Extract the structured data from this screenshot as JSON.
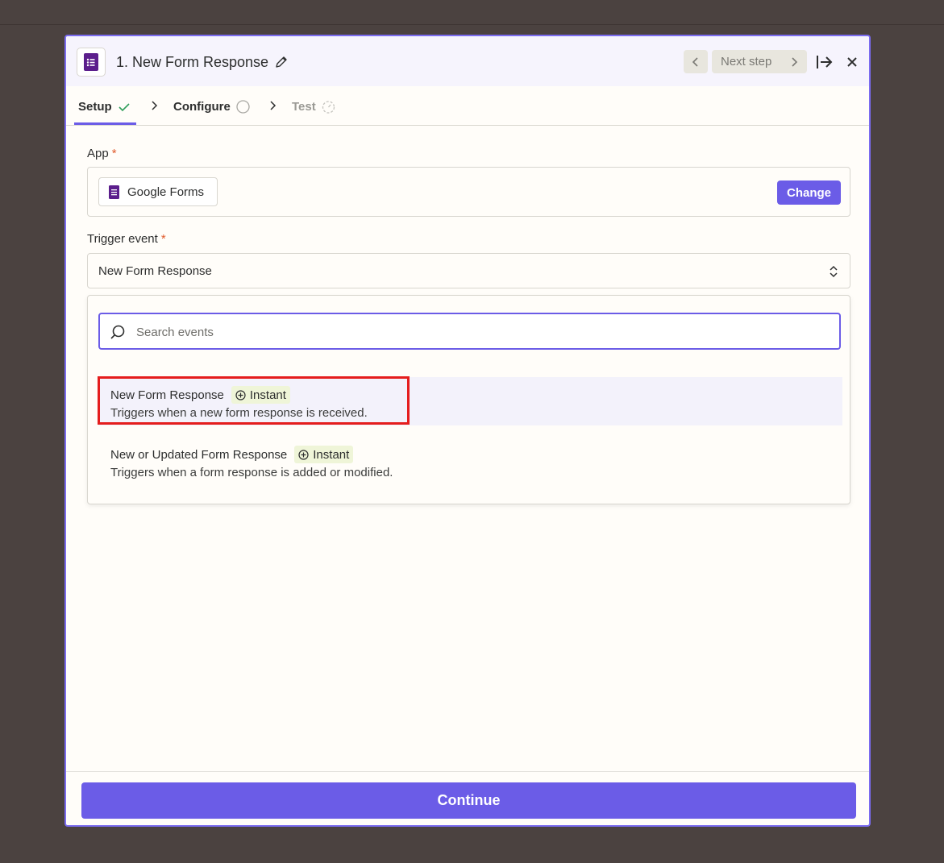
{
  "header": {
    "title": "1. New Form Response",
    "next_step_label": "Next step"
  },
  "tabs": [
    {
      "label": "Setup",
      "status": "complete"
    },
    {
      "label": "Configure",
      "status": "pending"
    },
    {
      "label": "Test",
      "status": "disabled"
    }
  ],
  "app_field": {
    "label": "App",
    "required_mark": "*",
    "app_name": "Google Forms",
    "change_label": "Change"
  },
  "trigger_field": {
    "label": "Trigger event",
    "required_mark": "*",
    "selected_value": "New Form Response"
  },
  "dropdown": {
    "search_placeholder": "Search events",
    "options": [
      {
        "title": "New Form Response",
        "badge": "Instant",
        "description": "Triggers when a new form response is received."
      },
      {
        "title": "New or Updated Form Response",
        "badge": "Instant",
        "description": "Triggers when a form response is added or modified."
      }
    ]
  },
  "footer": {
    "continue_label": "Continue"
  },
  "colors": {
    "accent": "#6b5ce7",
    "backdrop": "#4b4240",
    "google_forms_purple": "#5b1e8c",
    "badge_bg": "#eff5d8",
    "highlight_border": "#e51d1d",
    "success_check": "#2f9e5b"
  },
  "icons": {
    "app": "google-forms-icon",
    "edit": "pencil-icon",
    "prev": "chevron-left-icon",
    "next": "chevron-right-icon",
    "expand": "arrow-to-right-icon",
    "close": "close-icon",
    "search": "search-icon",
    "badge": "bolt-circle-icon"
  }
}
